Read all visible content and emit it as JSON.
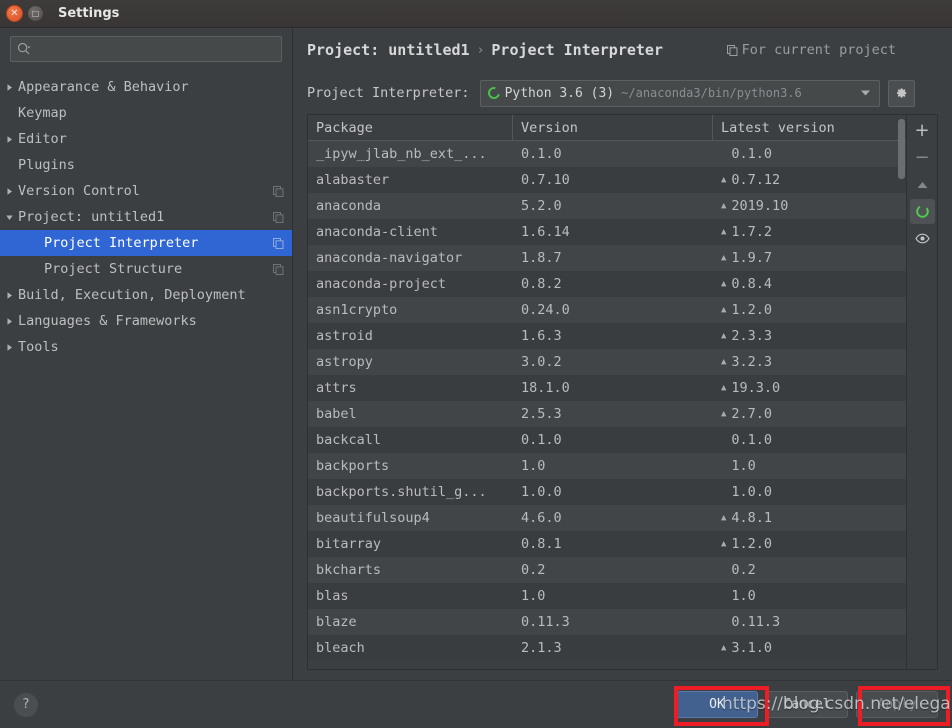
{
  "window": {
    "title": "Settings",
    "close_icon": "close-icon",
    "maximize_icon": "maximize-icon"
  },
  "search": {
    "value": "",
    "placeholder": "",
    "icon": "search-icon"
  },
  "sidebar": {
    "items": [
      {
        "label": "Appearance & Behavior",
        "arrow": "collapsed",
        "indent": false,
        "copy": false,
        "selected": false
      },
      {
        "label": "Keymap",
        "arrow": "none",
        "indent": false,
        "copy": false,
        "selected": false
      },
      {
        "label": "Editor",
        "arrow": "collapsed",
        "indent": false,
        "copy": false,
        "selected": false
      },
      {
        "label": "Plugins",
        "arrow": "none",
        "indent": false,
        "copy": false,
        "selected": false
      },
      {
        "label": "Version Control",
        "arrow": "collapsed",
        "indent": false,
        "copy": true,
        "selected": false
      },
      {
        "label": "Project: untitled1",
        "arrow": "expanded",
        "indent": false,
        "copy": true,
        "selected": false
      },
      {
        "label": "Project Interpreter",
        "arrow": "none",
        "indent": true,
        "copy": true,
        "selected": true
      },
      {
        "label": "Project Structure",
        "arrow": "none",
        "indent": true,
        "copy": true,
        "selected": false
      },
      {
        "label": "Build, Execution, Deployment",
        "arrow": "collapsed",
        "indent": false,
        "copy": false,
        "selected": false
      },
      {
        "label": "Languages & Frameworks",
        "arrow": "collapsed",
        "indent": false,
        "copy": false,
        "selected": false
      },
      {
        "label": "Tools",
        "arrow": "collapsed",
        "indent": false,
        "copy": false,
        "selected": false
      }
    ]
  },
  "breadcrumb": {
    "parent": "Project: untitled1",
    "separator": "›",
    "current": "Project Interpreter",
    "scope_icon": "copy-icon",
    "scope_text": "For current project"
  },
  "interpreter": {
    "label": "Project Interpreter:",
    "status_icon": "python-env-icon",
    "name": "Python 3.6 (3)",
    "path": "~/anaconda3/bin/python3.6",
    "dropdown_icon": "chevron-down-icon",
    "settings_icon": "gear-icon"
  },
  "table": {
    "columns": [
      "Package",
      "Version",
      "Latest version"
    ],
    "rows": [
      {
        "package": "_ipyw_jlab_nb_ext_...",
        "version": "0.1.0",
        "latest": "0.1.0",
        "upgradable": false
      },
      {
        "package": "alabaster",
        "version": "0.7.10",
        "latest": "0.7.12",
        "upgradable": true
      },
      {
        "package": "anaconda",
        "version": "5.2.0",
        "latest": "2019.10",
        "upgradable": true
      },
      {
        "package": "anaconda-client",
        "version": "1.6.14",
        "latest": "1.7.2",
        "upgradable": true
      },
      {
        "package": "anaconda-navigator",
        "version": "1.8.7",
        "latest": "1.9.7",
        "upgradable": true
      },
      {
        "package": "anaconda-project",
        "version": "0.8.2",
        "latest": "0.8.4",
        "upgradable": true
      },
      {
        "package": "asn1crypto",
        "version": "0.24.0",
        "latest": "1.2.0",
        "upgradable": true
      },
      {
        "package": "astroid",
        "version": "1.6.3",
        "latest": "2.3.3",
        "upgradable": true
      },
      {
        "package": "astropy",
        "version": "3.0.2",
        "latest": "3.2.3",
        "upgradable": true
      },
      {
        "package": "attrs",
        "version": "18.1.0",
        "latest": "19.3.0",
        "upgradable": true
      },
      {
        "package": "babel",
        "version": "2.5.3",
        "latest": "2.7.0",
        "upgradable": true
      },
      {
        "package": "backcall",
        "version": "0.1.0",
        "latest": "0.1.0",
        "upgradable": false
      },
      {
        "package": "backports",
        "version": "1.0",
        "latest": "1.0",
        "upgradable": false
      },
      {
        "package": "backports.shutil_g...",
        "version": "1.0.0",
        "latest": "1.0.0",
        "upgradable": false
      },
      {
        "package": "beautifulsoup4",
        "version": "4.6.0",
        "latest": "4.8.1",
        "upgradable": true
      },
      {
        "package": "bitarray",
        "version": "0.8.1",
        "latest": "1.2.0",
        "upgradable": true
      },
      {
        "package": "bkcharts",
        "version": "0.2",
        "latest": "0.2",
        "upgradable": false
      },
      {
        "package": "blas",
        "version": "1.0",
        "latest": "1.0",
        "upgradable": false
      },
      {
        "package": "blaze",
        "version": "0.11.3",
        "latest": "0.11.3",
        "upgradable": false
      },
      {
        "package": "bleach",
        "version": "2.1.3",
        "latest": "3.1.0",
        "upgradable": true
      }
    ],
    "upgrade_marker": "▲"
  },
  "side_tools": [
    {
      "name": "add-package-button",
      "icon": "plus-icon"
    },
    {
      "name": "remove-package-button",
      "icon": "minus-icon"
    },
    {
      "name": "upgrade-package-button",
      "icon": "triangle-up-icon"
    },
    {
      "name": "conda-env-button",
      "icon": "green-ring-icon"
    },
    {
      "name": "show-early-releases-button",
      "icon": "eye-icon"
    }
  ],
  "footer": {
    "help_label": "?",
    "ok_label": "OK",
    "cancel_label": "Cancel",
    "apply_label": "Apply"
  },
  "annotations": {
    "box_color": "#ee1c25",
    "watermark": "https://blog.csdn.net/elegantoo"
  }
}
